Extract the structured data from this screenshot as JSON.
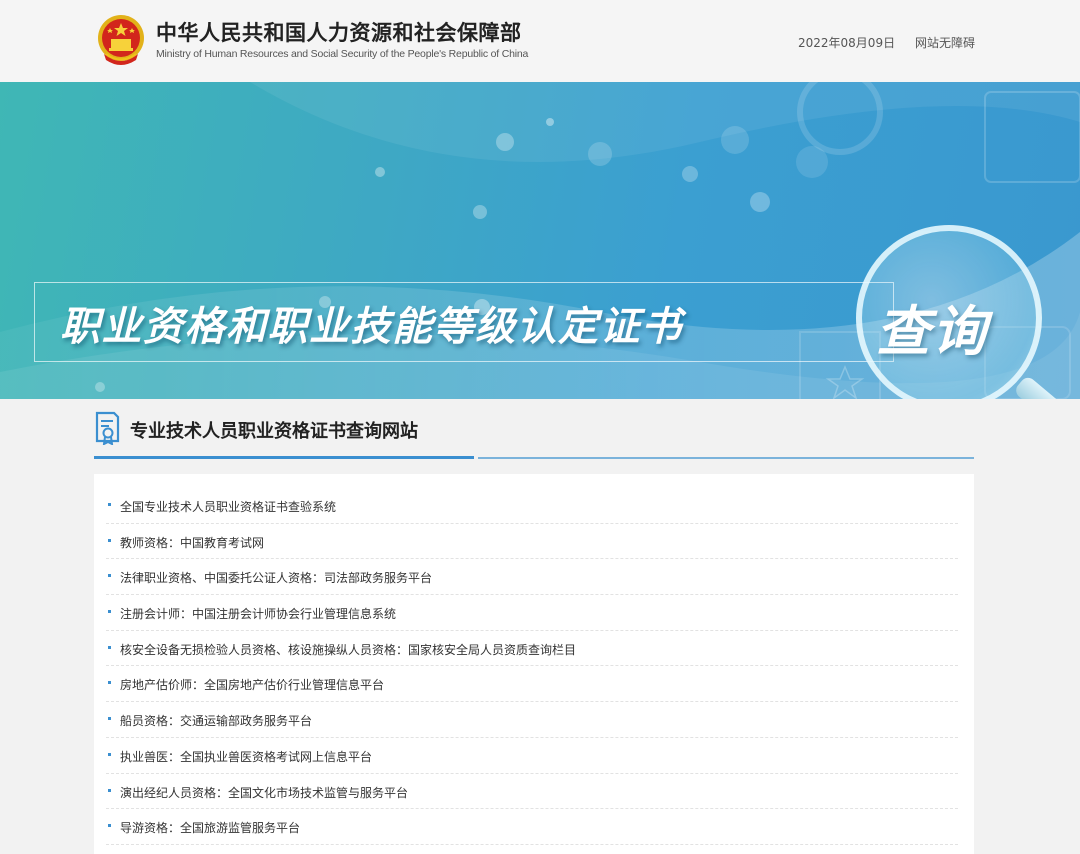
{
  "header": {
    "ministry_cn": "中华人民共和国人力资源和社会保障部",
    "ministry_en": "Ministry of Human Resources and Social Security of the People's Republic of China",
    "date": "2022年08月09日",
    "accessibility": "网站无障碍"
  },
  "banner": {
    "title": "职业资格和职业技能等级认定证书",
    "query_label": "查询"
  },
  "section": {
    "title": "专业技术人员职业资格证书查询网站",
    "items": [
      {
        "label": "全国专业技术人员职业资格证书查验系统"
      },
      {
        "label": "教师资格：中国教育考试网"
      },
      {
        "label": "法律职业资格、中国委托公证人资格：司法部政务服务平台"
      },
      {
        "label": "注册会计师：中国注册会计师协会行业管理信息系统"
      },
      {
        "label": "核安全设备无损检验人员资格、核设施操纵人员资格：国家核安全局人员资质查询栏目"
      },
      {
        "label": "房地产估价师：全国房地产估价行业管理信息平台"
      },
      {
        "label": "船员资格：交通运输部政务服务平台"
      },
      {
        "label": "执业兽医：全国执业兽医资格考试网上信息平台"
      },
      {
        "label": "演出经纪人员资格：全国文化市场技术监管与服务平台"
      },
      {
        "label": "导游资格：全国旅游监管服务平台"
      }
    ]
  },
  "colors": {
    "accent": "#3b8fd0",
    "emblem_red": "#d2261c",
    "emblem_gold": "#f0c419"
  }
}
